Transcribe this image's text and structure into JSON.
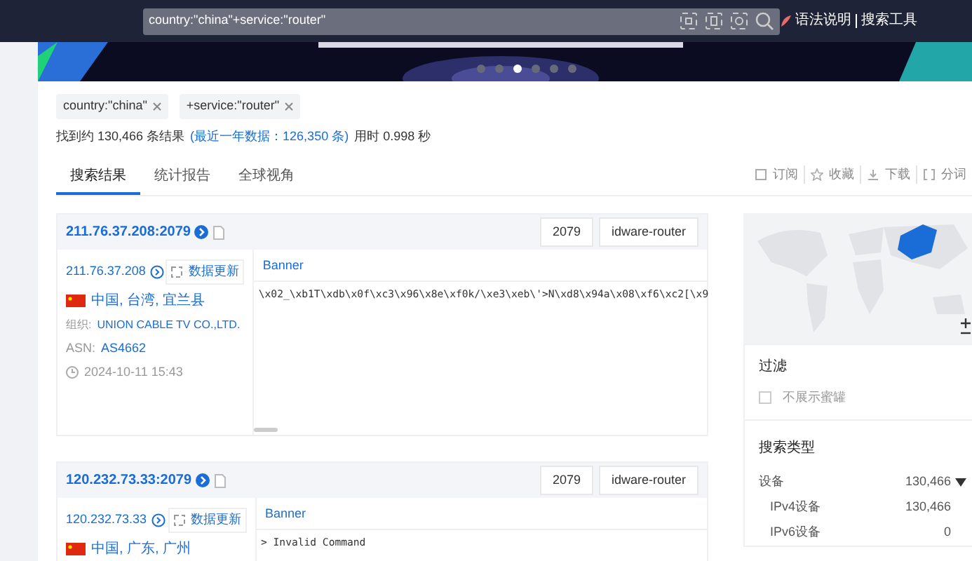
{
  "search": {
    "value": "country:\"china\"+service:\"router\""
  },
  "header_links": [
    "语法说明",
    "搜索工具"
  ],
  "carousel": {
    "dots": [
      {
        "selected": false
      },
      {
        "selected": false
      },
      {
        "selected": true
      },
      {
        "selected": false
      },
      {
        "selected": false
      },
      {
        "selected": false
      }
    ]
  },
  "filters": [
    {
      "label": "country:\"china\""
    },
    {
      "label": "+service:\"router\""
    }
  ],
  "summary": {
    "found": "找到约 130,466 条结果",
    "recent": "(最近一年数据：126,350 条)",
    "time": "用时 0.998 秒"
  },
  "tabs": [
    {
      "label": "搜索结果",
      "selected": true
    },
    {
      "label": "统计报告",
      "selected": false
    },
    {
      "label": "全球视角",
      "selected": false
    }
  ],
  "actions": [
    {
      "label": "订阅",
      "kind": "subscribe"
    },
    {
      "label": "收藏",
      "kind": "star"
    },
    {
      "label": "下载",
      "kind": "download"
    },
    {
      "label": "分词",
      "kind": "split"
    }
  ],
  "results": [
    {
      "title": "211.76.37.208:2079",
      "port": "2079",
      "service": "idware-router",
      "ip": "211.76.37.208",
      "update": "数据更新",
      "location": "中国, 台湾, 宜兰县",
      "org_label": "组织:",
      "org": "UNION CABLE TV CO.,LTD.",
      "asn_label": "ASN:",
      "asn": "AS4662",
      "time": "2024-10-11 15:43",
      "banner_label": "Banner",
      "banner": "\\x02_\\xb1T\\xdb\\x0f\\xc3\\x96\\x8e\\xf0k/\\xe3\\xeb\\'>N\\xd8\\x94a\\x08\\xf6\\xc2[\\x9"
    },
    {
      "title": "120.232.73.33:2079",
      "port": "2079",
      "service": "idware-router",
      "ip": "120.232.73.33",
      "update": "数据更新",
      "location": "中国, 广东, 广州",
      "banner_label": "Banner",
      "banner": "> Invalid Command"
    }
  ],
  "sidebar": {
    "filter_title": "过滤",
    "honeypot": {
      "label": "不展示蜜罐",
      "checked": false
    },
    "type_title": "搜索类型",
    "types": [
      {
        "label": "设备",
        "count": "130,466",
        "expanded": true,
        "children": [
          {
            "label": "IPv4设备",
            "count": "130,466"
          },
          {
            "label": "IPv6设备",
            "count": "0"
          }
        ]
      }
    ]
  }
}
